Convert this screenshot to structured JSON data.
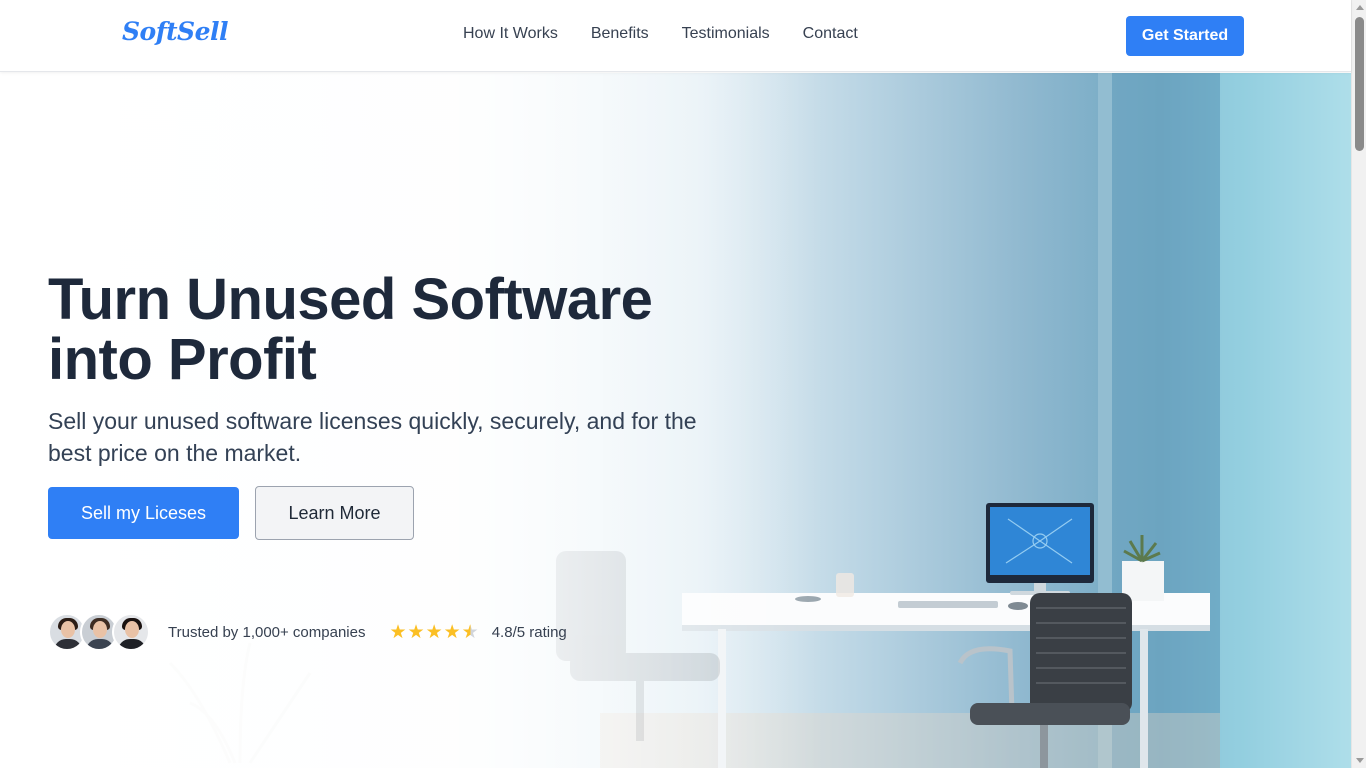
{
  "header": {
    "logo": "SoftSell",
    "nav": [
      "How It Works",
      "Benefits",
      "Testimonials",
      "Contact"
    ],
    "cta_label": "Get Started"
  },
  "hero": {
    "headline": "Turn Unused Software into Profit",
    "subheadline": "Sell your unused software licenses quickly, securely, and for the best price on the market.",
    "primary_button": "Sell my Liceses",
    "secondary_button": "Learn More",
    "trust_text": "Trusted by 1,000+ companies",
    "rating_text": "4.8/5 rating",
    "rating_value": 4.8,
    "rating_max": 5
  },
  "colors": {
    "accent": "#2f7ff5",
    "heading": "#1e293b",
    "star": "#fbbf24"
  },
  "icons": {
    "stars": [
      "star-icon",
      "star-icon",
      "star-icon",
      "star-icon",
      "star-half-icon"
    ]
  }
}
